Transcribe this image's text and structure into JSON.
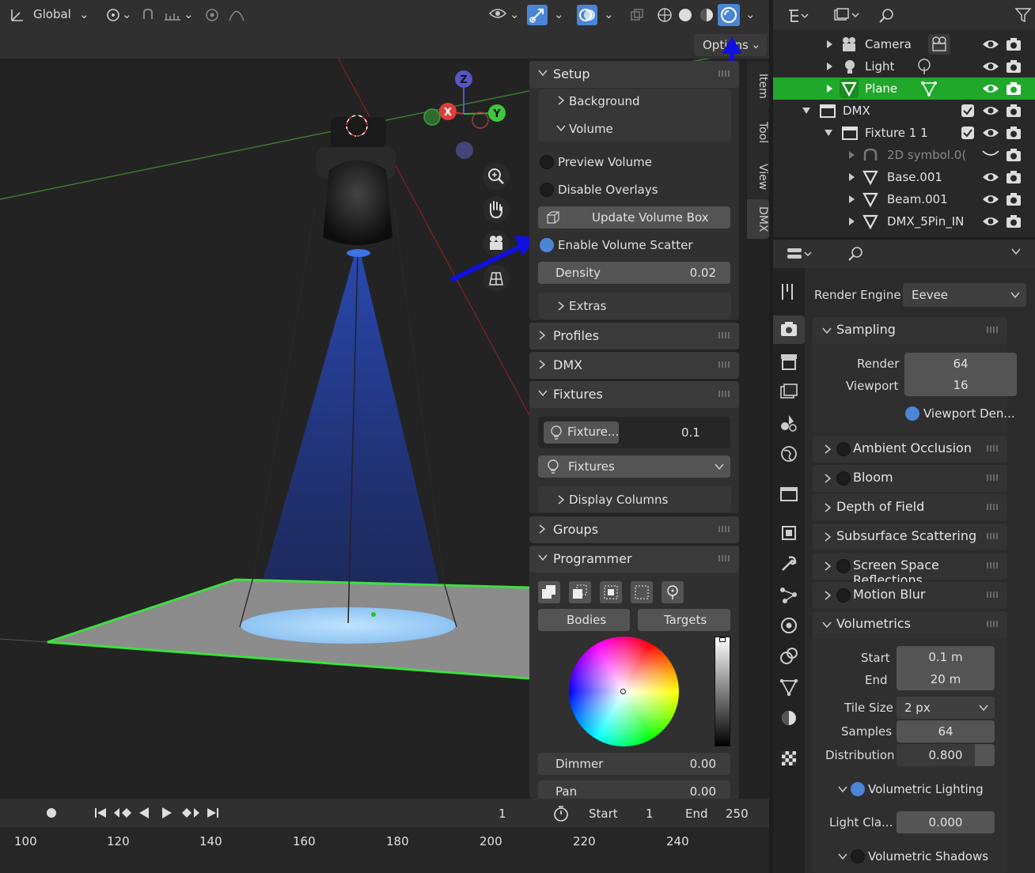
{
  "viewport": {
    "orientation": "Global",
    "options_label": "Options",
    "gizmo": {
      "x": "X",
      "y": "Y",
      "z": "Z"
    }
  },
  "npanel": {
    "tabs": [
      "Item",
      "Tool",
      "View",
      "DMX"
    ],
    "setup": {
      "title": "Setup",
      "background": "Background",
      "volume": "Volume",
      "preview_volume": "Preview Volume",
      "disable_overlays": "Disable Overlays",
      "update_volume_box": "Update Volume Box",
      "enable_volume_scatter": "Enable Volume Scatter",
      "density_label": "Density",
      "density_value": "0.02",
      "extras": "Extras"
    },
    "profiles": "Profiles",
    "dmx": "DMX",
    "fixtures": {
      "title": "Fixtures",
      "fixture_btn": "Fixture...",
      "fixture_value": "0.1",
      "fixtures_select": "Fixtures",
      "display_columns": "Display Columns"
    },
    "groups": "Groups",
    "programmer": {
      "title": "Programmer",
      "bodies": "Bodies",
      "targets": "Targets",
      "dimmer_label": "Dimmer",
      "dimmer_value": "0.00",
      "pan_label": "Pan",
      "pan_value": "0.00"
    }
  },
  "timeline": {
    "current_frame": "1",
    "start_label": "Start",
    "start_value": "1",
    "end_label": "End",
    "end_value": "250",
    "ruler": [
      "100",
      "120",
      "140",
      "160",
      "180",
      "200",
      "220",
      "240"
    ]
  },
  "outliner": {
    "items": [
      {
        "name": "Camera",
        "depth": 1,
        "color": "normal"
      },
      {
        "name": "Light",
        "depth": 1,
        "color": "normal"
      },
      {
        "name": "Plane",
        "depth": 1,
        "color": "selected"
      },
      {
        "name": "DMX",
        "depth": 0,
        "color": "normal"
      },
      {
        "name": "Fixture 1 1",
        "depth": 1,
        "color": "normal"
      },
      {
        "name": "2D symbol.0(",
        "depth": 2,
        "color": "dim"
      },
      {
        "name": "Base.001",
        "depth": 2,
        "color": "normal"
      },
      {
        "name": "Beam.001",
        "depth": 2,
        "color": "normal"
      },
      {
        "name": "DMX_5Pin_IN",
        "depth": 2,
        "color": "normal"
      }
    ]
  },
  "properties": {
    "render_engine_label": "Render Engine",
    "render_engine_value": "Eevee",
    "sampling": {
      "title": "Sampling",
      "render_label": "Render",
      "render_value": "64",
      "viewport_label": "Viewport",
      "viewport_value": "16",
      "viewport_denoise": "Viewport Den..."
    },
    "sections": [
      "Ambient Occlusion",
      "Bloom",
      "Depth of Field",
      "Subsurface Scattering",
      "Screen Space Reflections",
      "Motion Blur"
    ],
    "volumetrics": {
      "title": "Volumetrics",
      "start_label": "Start",
      "start_value": "0.1 m",
      "end_label": "End",
      "end_value": "20 m",
      "tile_size_label": "Tile Size",
      "tile_size_value": "2 px",
      "samples_label": "Samples",
      "samples_value": "64",
      "distribution_label": "Distribution",
      "distribution_value": "0.800",
      "volumetric_lighting": "Volumetric Lighting",
      "light_clamp_label": "Light Cla...",
      "light_clamp_value": "0.000",
      "volumetric_shadows": "Volumetric Shadows"
    }
  },
  "colors": {
    "accent_blue": "#4a85d6",
    "selection_green": "#1fa82a",
    "annotation_arrow": "#1010e0"
  }
}
